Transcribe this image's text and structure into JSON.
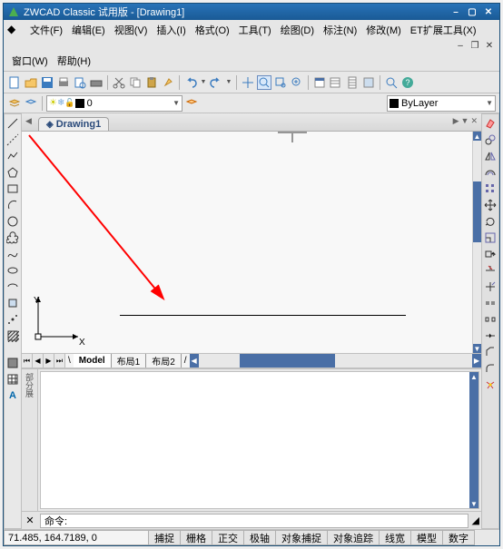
{
  "titlebar": {
    "app_title": "ZWCAD Classic 试用版 - [Drawing1]"
  },
  "menus": {
    "file": "文件(F)",
    "edit": "编辑(E)",
    "view": "视图(V)",
    "insert": "插入(I)",
    "format": "格式(O)",
    "tools": "工具(T)",
    "draw": "绘图(D)",
    "dimension": "标注(N)",
    "modify": "修改(M)",
    "ettools": "ET扩展工具(X)",
    "window": "窗口(W)",
    "help": "帮助(H)"
  },
  "toolbar2": {
    "layer_value": "0",
    "current_layer": "ByLayer"
  },
  "document": {
    "tab_name": "Drawing1",
    "model_tab": "Model",
    "layout1": "布局1",
    "layout2": "布局2"
  },
  "canvas": {
    "x_label": "X",
    "y_label": "Y"
  },
  "command": {
    "side_label": "部分展",
    "prompt": "命令:"
  },
  "statusbar": {
    "coords": "71.485,  164.7189,   0",
    "snap": "捕捉",
    "grid": "栅格",
    "ortho": "正交",
    "polar": "极轴",
    "osnap": "对象捕捉",
    "otrack": "对象追踪",
    "lwt": "线宽",
    "model": "模型",
    "digit": "数字"
  }
}
